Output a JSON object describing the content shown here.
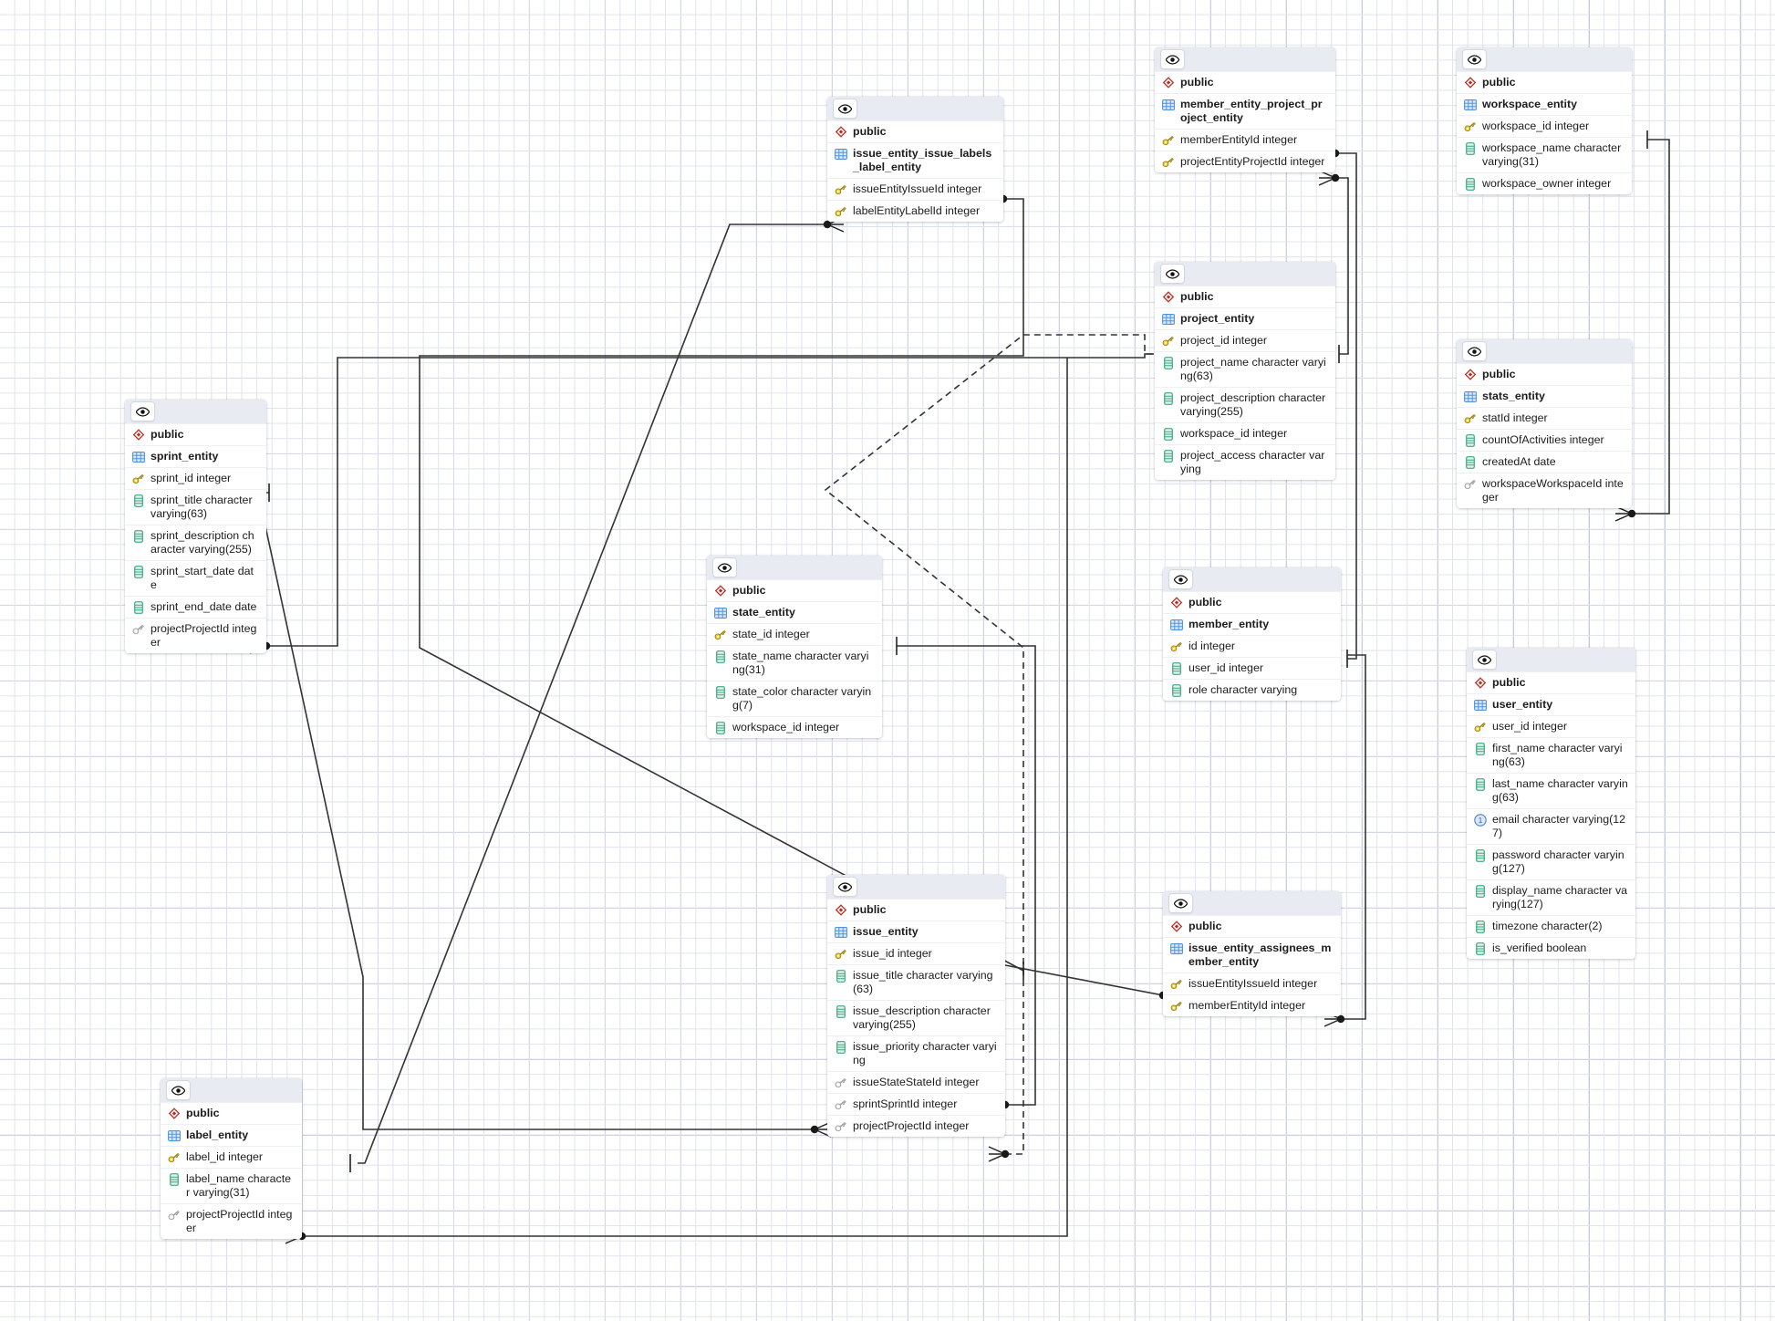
{
  "diagram": {
    "kind": "er-diagram",
    "schema_label": "public",
    "colors": {
      "grid_minor": "#dfe3ec",
      "grid_major": "#b9bfd0",
      "header_bg": "#e8ecf2",
      "table_bg": "#ffffff",
      "edge": "#333333",
      "pk_key": "#e8c33a",
      "fk_key": "#b9bcc4",
      "column_icon": "#44b08a",
      "table_icon": "#5aa0e8",
      "schema_icon": "#c0392b",
      "unique_index": "#4a7fd0"
    },
    "icons": {
      "eye": "eye-icon",
      "schema": "schema-diamond-icon",
      "table": "table-grid-icon",
      "primary_key": "primary-key-icon",
      "foreign_key": "foreign-key-icon",
      "column": "column-icon",
      "unique_index": "unique-index-icon"
    }
  },
  "tables": [
    {
      "id": "sprint_entity",
      "schema": "public",
      "name": "sprint_entity",
      "columns": [
        {
          "name": "sprint_id integer",
          "icon": "primary_key"
        },
        {
          "name": "sprint_title character varying(63)",
          "icon": "column"
        },
        {
          "name": "sprint_description character varying(255)",
          "icon": "column"
        },
        {
          "name": "sprint_start_date date",
          "icon": "column"
        },
        {
          "name": "sprint_end_date date",
          "icon": "column"
        },
        {
          "name": "projectProjectId integer",
          "icon": "foreign_key"
        }
      ]
    },
    {
      "id": "label_entity",
      "schema": "public",
      "name": "label_entity",
      "columns": [
        {
          "name": "label_id integer",
          "icon": "primary_key"
        },
        {
          "name": "label_name character varying(31)",
          "icon": "column"
        },
        {
          "name": "projectProjectId integer",
          "icon": "foreign_key"
        }
      ]
    },
    {
      "id": "state_entity",
      "schema": "public",
      "name": "state_entity",
      "columns": [
        {
          "name": "state_id integer",
          "icon": "primary_key"
        },
        {
          "name": "state_name character varying(31)",
          "icon": "column"
        },
        {
          "name": "state_color character varying(7)",
          "icon": "column"
        },
        {
          "name": "workspace_id integer",
          "icon": "column"
        }
      ]
    },
    {
      "id": "issue_entity_issue_labels_label_entity",
      "schema": "public",
      "name": "issue_entity_issue_labels_label_entity",
      "columns": [
        {
          "name": "issueEntityIssueId integer",
          "icon": "primary_key"
        },
        {
          "name": "labelEntityLabelId integer",
          "icon": "primary_key"
        }
      ]
    },
    {
      "id": "issue_entity",
      "schema": "public",
      "name": "issue_entity",
      "columns": [
        {
          "name": "issue_id integer",
          "icon": "primary_key"
        },
        {
          "name": "issue_title character varying(63)",
          "icon": "column"
        },
        {
          "name": "issue_description character varying(255)",
          "icon": "column"
        },
        {
          "name": "issue_priority character varying",
          "icon": "column"
        },
        {
          "name": "issueStateStateId integer",
          "icon": "foreign_key"
        },
        {
          "name": "sprintSprintId integer",
          "icon": "foreign_key"
        },
        {
          "name": "projectProjectId integer",
          "icon": "foreign_key"
        }
      ]
    },
    {
      "id": "member_entity_project_project_entity",
      "schema": "public",
      "name": "member_entity_project_project_entity",
      "columns": [
        {
          "name": "memberEntityId integer",
          "icon": "primary_key"
        },
        {
          "name": "projectEntityProjectId integer",
          "icon": "primary_key"
        }
      ]
    },
    {
      "id": "project_entity",
      "schema": "public",
      "name": "project_entity",
      "columns": [
        {
          "name": "project_id integer",
          "icon": "primary_key"
        },
        {
          "name": "project_name character varying(63)",
          "icon": "column"
        },
        {
          "name": "project_description character varying(255)",
          "icon": "column"
        },
        {
          "name": "workspace_id integer",
          "icon": "column"
        },
        {
          "name": "project_access character varying",
          "icon": "column"
        }
      ]
    },
    {
      "id": "member_entity",
      "schema": "public",
      "name": "member_entity",
      "columns": [
        {
          "name": "id integer",
          "icon": "primary_key"
        },
        {
          "name": "user_id integer",
          "icon": "column"
        },
        {
          "name": "role character varying",
          "icon": "column"
        }
      ]
    },
    {
      "id": "issue_entity_assignees_member_entity",
      "schema": "public",
      "name": "issue_entity_assignees_member_entity",
      "columns": [
        {
          "name": "issueEntityIssueId integer",
          "icon": "primary_key"
        },
        {
          "name": "memberEntityId integer",
          "icon": "primary_key"
        }
      ]
    },
    {
      "id": "workspace_entity",
      "schema": "public",
      "name": "workspace_entity",
      "columns": [
        {
          "name": "workspace_id integer",
          "icon": "primary_key"
        },
        {
          "name": "workspace_name character varying(31)",
          "icon": "column"
        },
        {
          "name": "workspace_owner integer",
          "icon": "column"
        }
      ]
    },
    {
      "id": "stats_entity",
      "schema": "public",
      "name": "stats_entity",
      "columns": [
        {
          "name": "statId integer",
          "icon": "primary_key"
        },
        {
          "name": "countOfActivities integer",
          "icon": "column"
        },
        {
          "name": "createdAt date",
          "icon": "column"
        },
        {
          "name": "workspaceWorkspaceId integer",
          "icon": "foreign_key"
        }
      ]
    },
    {
      "id": "user_entity",
      "schema": "public",
      "name": "user_entity",
      "columns": [
        {
          "name": "user_id integer",
          "icon": "primary_key"
        },
        {
          "name": "first_name character varying(63)",
          "icon": "column"
        },
        {
          "name": "last_name character varying(63)",
          "icon": "column"
        },
        {
          "name": "email character varying(127)",
          "icon": "unique_index"
        },
        {
          "name": "password character varying(127)",
          "icon": "column"
        },
        {
          "name": "display_name character varying(127)",
          "icon": "column"
        },
        {
          "name": "timezone character(2)",
          "icon": "column"
        },
        {
          "name": "is_verified boolean",
          "icon": "column"
        }
      ]
    }
  ],
  "relationships": [
    {
      "from": "issue_entity_issue_labels_label_entity.issueEntityIssueId",
      "to": "issue_entity.issue_id",
      "style": "solid"
    },
    {
      "from": "issue_entity_issue_labels_label_entity.labelEntityLabelId",
      "to": "label_entity.label_id",
      "style": "solid"
    },
    {
      "from": "member_entity_project_project_entity.memberEntityId",
      "to": "member_entity.id",
      "style": "solid"
    },
    {
      "from": "member_entity_project_project_entity.projectEntityProjectId",
      "to": "project_entity.project_id",
      "style": "solid"
    },
    {
      "from": "stats_entity.workspaceWorkspaceId",
      "to": "workspace_entity.workspace_id",
      "style": "solid"
    },
    {
      "from": "sprint_entity.projectProjectId",
      "to": "project_entity.project_id",
      "style": "solid"
    },
    {
      "from": "label_entity.projectProjectId",
      "to": "project_entity.project_id",
      "style": "solid"
    },
    {
      "from": "issue_entity.issueStateStateId",
      "to": "state_entity.state_id",
      "style": "solid"
    },
    {
      "from": "issue_entity.sprintSprintId",
      "to": "sprint_entity.sprint_id",
      "style": "solid"
    },
    {
      "from": "issue_entity.projectProjectId",
      "to": "project_entity.project_id",
      "style": "dashed"
    },
    {
      "from": "issue_entity_assignees_member_entity.issueEntityIssueId",
      "to": "issue_entity.issue_id",
      "style": "solid"
    },
    {
      "from": "issue_entity_assignees_member_entity.memberEntityId",
      "to": "member_entity.id",
      "style": "solid"
    }
  ]
}
